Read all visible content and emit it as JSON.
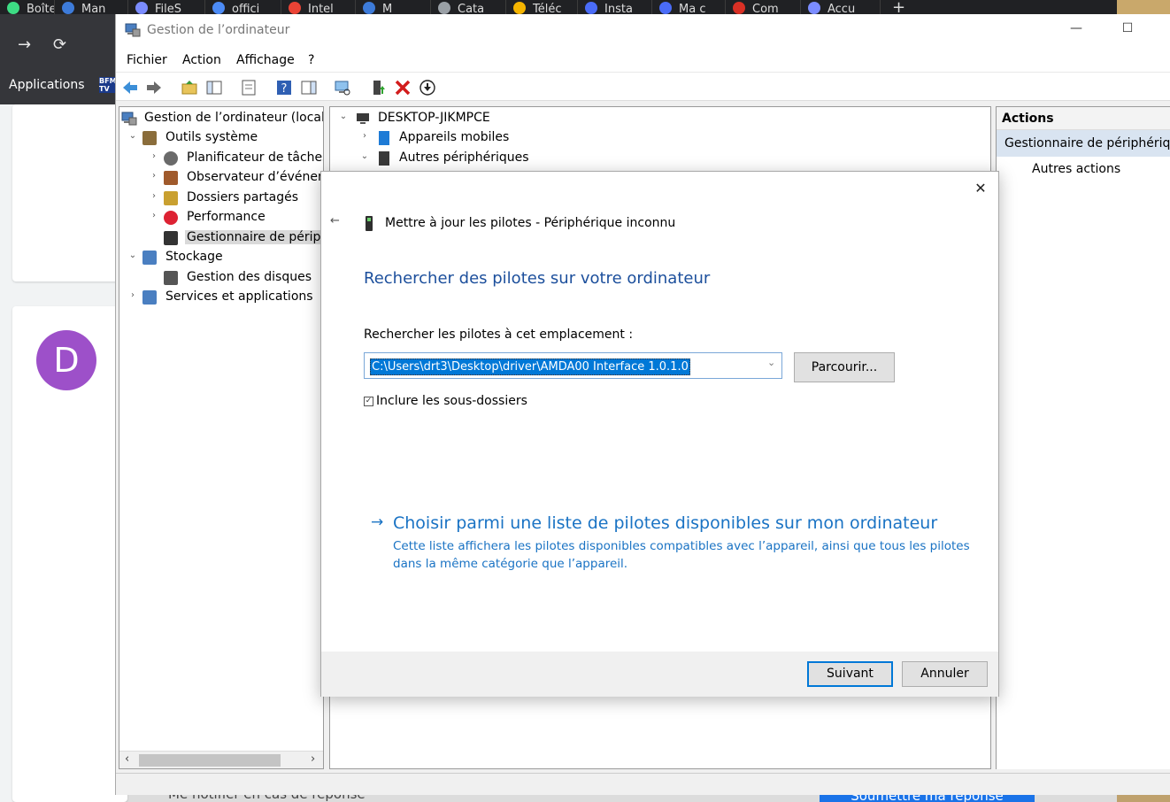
{
  "browser": {
    "tabs": [
      {
        "label": "Boîte",
        "color": "#3ddc84"
      },
      {
        "label": "Man",
        "color": "#3d7bd9"
      },
      {
        "label": "FileS",
        "color": "#7b8cff"
      },
      {
        "label": "offici",
        "color": "#4c8bf5"
      },
      {
        "label": "Intel",
        "color": "#ea4335"
      },
      {
        "label": "M",
        "color": "#3d7bd9"
      },
      {
        "label": "Cata",
        "color": "#9aa0a6"
      },
      {
        "label": "Téléc",
        "color": "#f4b400"
      },
      {
        "label": "Insta",
        "color": "#4a6cf7"
      },
      {
        "label": "Ma c",
        "color": "#4a6cf7"
      },
      {
        "label": "Com",
        "color": "#d93025"
      },
      {
        "label": "Accu",
        "color": "#7b8cff"
      }
    ],
    "new_tab": "+",
    "bookmark_apps": "Applications",
    "bookmark_bfm": "BFM TV",
    "avatar_letter": "D",
    "bottom_left_text": "Me notifier en cas de réponse",
    "bottom_button": "Soumettre ma réponse"
  },
  "window": {
    "title": "Gestion de l’ordinateur",
    "minimize": "—",
    "maximize": "☐"
  },
  "menu": [
    "Fichier",
    "Action",
    "Affichage",
    "?"
  ],
  "tree": {
    "root": "Gestion de l’ordinateur (local)",
    "items": [
      {
        "label": "Outils système",
        "chev": "⌄",
        "indent": 1
      },
      {
        "label": "Planificateur de tâches",
        "chev": "›",
        "indent": 2
      },
      {
        "label": "Observateur d’événements",
        "chev": "›",
        "indent": 2
      },
      {
        "label": "Dossiers partagés",
        "chev": "›",
        "indent": 2
      },
      {
        "label": "Performance",
        "chev": "›",
        "indent": 2
      },
      {
        "label": "Gestionnaire de périphériques",
        "chev": "",
        "indent": 2
      },
      {
        "label": "Stockage",
        "chev": "⌄",
        "indent": 1
      },
      {
        "label": "Gestion des disques",
        "chev": "",
        "indent": 2
      },
      {
        "label": "Services et applications",
        "chev": "›",
        "indent": 1
      }
    ]
  },
  "center": {
    "computer": "DESKTOP-JIKMPCE",
    "items": [
      {
        "label": "Appareils mobiles",
        "chev": "›"
      },
      {
        "label": "Autres périphériques",
        "chev": "⌄"
      }
    ]
  },
  "actions": {
    "header": "Actions",
    "selected": "Gestionnaire de périphériques",
    "more": "Autres actions"
  },
  "dialog": {
    "title": "Mettre à jour les pilotes - Périphérique inconnu",
    "heading": "Rechercher des pilotes sur votre ordinateur",
    "search_label": "Rechercher les pilotes à cet emplacement :",
    "path_value": "C:\\Users\\drt3\\Desktop\\driver\\AMDA00 Interface 1.0.1.0",
    "browse_label": "Parcourir...",
    "include_subfolders": "Inclure les sous-dossiers",
    "include_checked": true,
    "link_title": "Choisir parmi une liste de pilotes disponibles sur mon ordinateur",
    "link_desc": "Cette liste affichera les pilotes disponibles compatibles avec l’appareil, ainsi que tous les pilotes dans la même catégorie que l’appareil.",
    "next_label": "Suivant",
    "cancel_label": "Annuler",
    "close_label": "✕",
    "back_label": "←"
  },
  "colors": {
    "accent_blue": "#0078d7",
    "link_blue": "#1a73c4",
    "heading_blue": "#1c4f9c",
    "selected_bg": "#d9e4f1"
  }
}
